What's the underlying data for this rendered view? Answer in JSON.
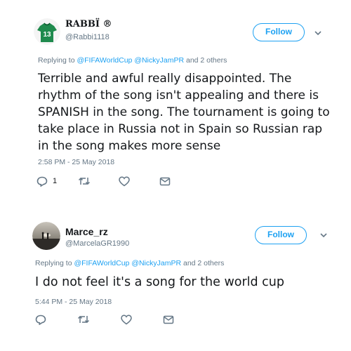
{
  "tweets": [
    {
      "display_name": "RABBÏ ®",
      "handle": "@Rabbi1118",
      "follow_label": "Follow",
      "replying_prefix": "Replying to",
      "mention_1": "@FIFAWorldCup",
      "mention_2": "@NickyJamPR",
      "replying_suffix": "and 2 others",
      "text": "Terrible and awful really disappointed. The rhythm of the song isn't appealing and there is SPANISH in the song. The tournament is going to take place in Russia not in Spain so Russian rap in the song makes more sense",
      "timestamp": "2:58 PM - 25 May 2018",
      "reply_count": "1",
      "avatar_jersey_number": "13"
    },
    {
      "display_name": "Marce_rz",
      "handle": "@MarcelaGR1990",
      "follow_label": "Follow",
      "replying_prefix": "Replying to",
      "mention_1": "@FIFAWorldCup",
      "mention_2": "@NickyJamPR",
      "replying_suffix": "and 2 others",
      "text": "I do not feel it's a song for the world cup",
      "timestamp": "5:44 PM - 25 May 2018"
    }
  ],
  "colors": {
    "accent": "#1da1f2",
    "muted": "#657786",
    "text": "#14171a",
    "jersey": "#1f8a4d"
  },
  "icons": [
    "reply-icon",
    "retweet-icon",
    "like-icon",
    "dm-icon",
    "chevron-down-icon"
  ]
}
